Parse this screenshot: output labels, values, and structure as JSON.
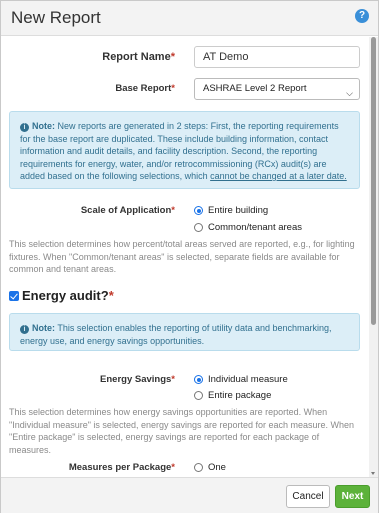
{
  "dialog": {
    "title": "New Report",
    "help_icon": "question-circle-icon",
    "help_glyph": "?"
  },
  "form": {
    "report_name": {
      "label": "Report Name",
      "required_mark": "*",
      "value": "AT Demo"
    },
    "base_report": {
      "label": "Base Report",
      "required_mark": "*",
      "selected": "ASHRAE Level 2 Report"
    },
    "note1": {
      "icon": "info-circle-icon",
      "icon_glyph": "i",
      "bold": "Note:",
      "text": " New reports are generated in 2 steps: First, the reporting requirements for the base report are duplicated. These include building information, contact information and audit details, and facility description. Second, the reporting requirements for energy, water, and/or retrocommissioning (RCx) audit(s) are added based on the following selections, which ",
      "underlined": "cannot be changed at a later date."
    },
    "scale": {
      "label": "Scale of Application",
      "required_mark": "*",
      "options": [
        {
          "label": "Entire building",
          "selected": true
        },
        {
          "label": "Common/tenant areas",
          "selected": false
        }
      ],
      "help": "This selection determines how percent/total areas served are reported, e.g., for lighting fixtures. When \"Common/tenant areas\" is selected, separate fields are available for common and tenant areas."
    },
    "energy_audit": {
      "label": "Energy audit?",
      "required_mark": "*",
      "checked": true
    },
    "note2": {
      "icon": "info-circle-icon",
      "icon_glyph": "i",
      "bold": "Note:",
      "text": " This selection enables the reporting of utility data and benchmarking, energy use, and energy savings opportunities."
    },
    "energy_savings": {
      "label": "Energy Savings",
      "required_mark": "*",
      "options": [
        {
          "label": "Individual measure",
          "selected": true
        },
        {
          "label": "Entire package",
          "selected": false
        }
      ],
      "help": "This selection determines how energy savings opportunities are reported. When \"Individual measure\" is selected, energy savings are reported for each measure. When \"Entire package\" is selected, energy savings are reported for each package of measures."
    },
    "measures_per_package": {
      "label": "Measures per Package",
      "required_mark": "*",
      "options": [
        {
          "label": "One",
          "selected": false
        }
      ]
    }
  },
  "footer": {
    "cancel_label": "Cancel",
    "next_label": "Next"
  },
  "colors": {
    "primary": "#1a73e8",
    "next_button": "#5cb23a",
    "note_bg": "#dceef7",
    "required": "#c0392b"
  }
}
